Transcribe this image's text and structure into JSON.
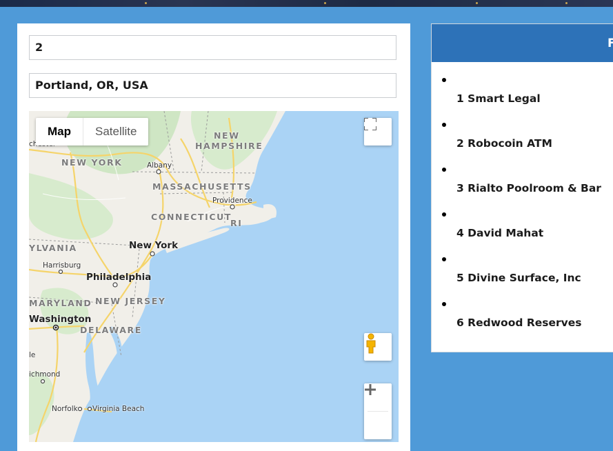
{
  "form": {
    "count_value": "2",
    "location_value": "Portland, OR, USA"
  },
  "map": {
    "type_controls": {
      "map_label": "Map",
      "satellite_label": "Satellite",
      "selected": "Map"
    },
    "labels": {
      "states": {
        "new_hampshire_1": "NEW",
        "new_hampshire_2": "HAMPSHIRE",
        "new_york": "NEW YORK",
        "massachusetts": "MASSACHUSETTS",
        "connecticut": "CONNECTICUT",
        "ri": "RI",
        "pennsylvania": "YLVANIA",
        "new_jersey": "NEW JERSEY",
        "maryland": "MARYLAND",
        "delaware": "DELAWARE"
      },
      "cities": {
        "albany": "Albany",
        "providence": "Providence",
        "new_york": "New York",
        "harrisburg": "Harrisburg",
        "philadelphia": "Philadelphia",
        "washington": "Washington",
        "richmond": "ichmond",
        "norfolk": "Norfolk",
        "virginia_beach": "Virginia Beach",
        "rochester": "chester",
        "left_partial": "le"
      }
    },
    "icons": {
      "fullscreen": "fullscreen-icon",
      "pegman": "pegman-icon",
      "zoom_in": "plus-icon",
      "zoom_out": "minus-icon"
    },
    "colors": {
      "water": "#aad3f5",
      "land": "#f1efe9",
      "forest": "#cfe6c4",
      "highway": "#f5d46a"
    }
  },
  "results": {
    "header_partial": "F",
    "items": [
      {
        "label": "1 Smart Legal"
      },
      {
        "label": "2 Robocoin ATM"
      },
      {
        "label": "3 Rialto Poolroom & Bar"
      },
      {
        "label": "4 David Mahat"
      },
      {
        "label": "5 Divine Surface, Inc"
      },
      {
        "label": "6 Redwood Reserves"
      }
    ]
  },
  "colors": {
    "page_background": "#4f9ad8",
    "header_blue": "#2d72b8"
  }
}
